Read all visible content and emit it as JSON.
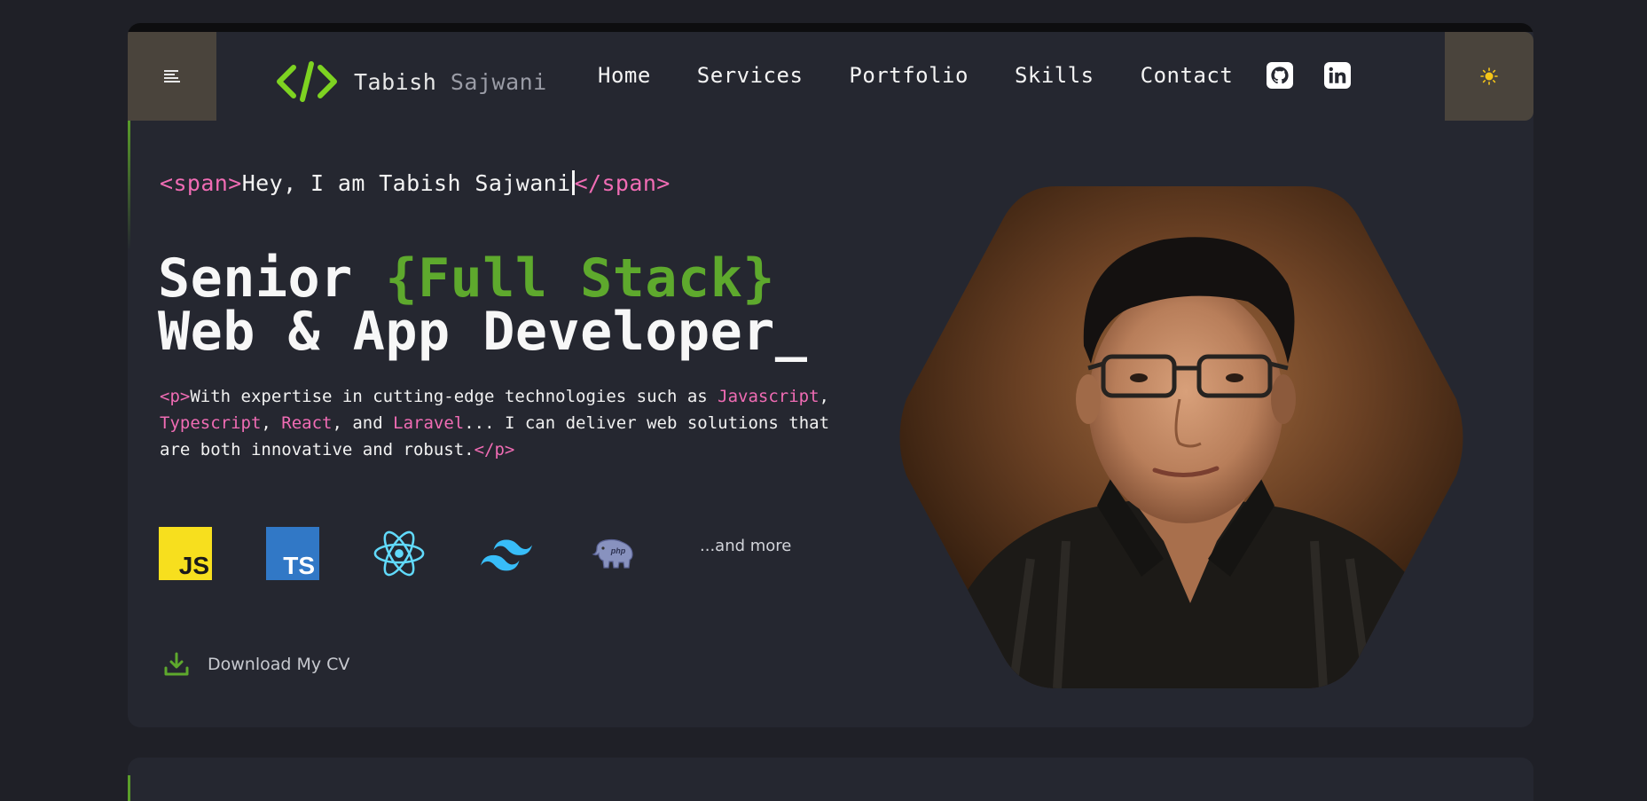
{
  "header": {
    "logo_first": "Tabish",
    "logo_last": " Sajwani",
    "nav": [
      "Home",
      "Services",
      "Portfolio",
      "Skills",
      "Contact"
    ],
    "icons": {
      "menu": "menu-icon",
      "logo": "code-brackets-icon",
      "github": "github-icon",
      "linkedin": "linkedin-icon",
      "theme": "sun-icon"
    }
  },
  "hero": {
    "greeting_open": "<span>",
    "greeting_text": "Hey, I am Tabish Sajwani",
    "greeting_close": "</span>",
    "headline_line1_prefix": "Senior ",
    "headline_line1_accent": "{Full Stack}",
    "headline_line2": "Web & App Developer_",
    "desc": {
      "open_tag": "<p>",
      "part1": "With expertise in cutting-edge technologies such as ",
      "tech1": "Javascript",
      "sep1": ", ",
      "tech2": "Typescript",
      "sep2": ", ",
      "tech3": "React",
      "sep3": ", and ",
      "tech4": "Laravel",
      "part2": "... I can deliver web solutions that are both innovative and robust.",
      "close_tag": "</p>"
    },
    "tech_badges": {
      "js": "JS",
      "ts": "TS",
      "php": "php"
    },
    "tech_icon_names": [
      "javascript-icon",
      "typescript-icon",
      "react-icon",
      "tailwind-icon",
      "php-elephant-icon"
    ],
    "and_more": "...and more",
    "download_label": "Download My CV"
  },
  "colors": {
    "background": "#1f2027",
    "card": "#252730",
    "accent_green": "#5ea92d",
    "tag_pink": "#f06cb4",
    "button_brown": "#4a443c"
  }
}
